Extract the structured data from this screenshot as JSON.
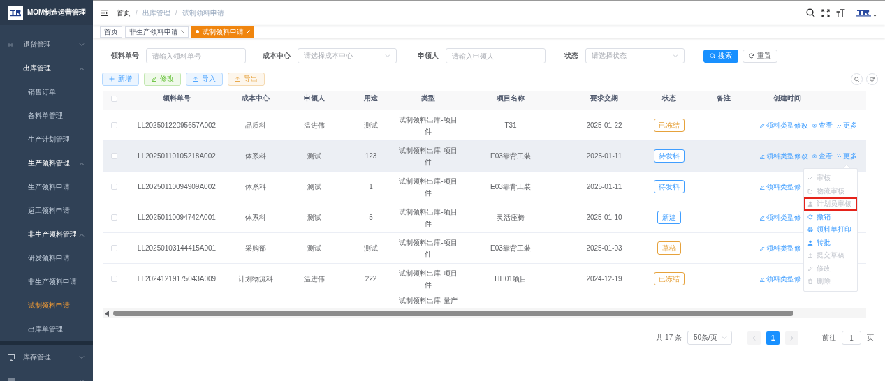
{
  "sidebar": {
    "title": "MOM制造运营管理",
    "items": [
      {
        "label": "退货管理",
        "expanded": false
      },
      {
        "label": "出库管理",
        "expanded": true,
        "children": [
          {
            "label": "销售订单",
            "selected": false
          },
          {
            "label": "备料单管理",
            "selected": false
          },
          {
            "label": "生产计划管理",
            "selected": false
          },
          {
            "label": "生产领料管理",
            "expanded": true,
            "children": [
              {
                "label": "生产领料申请",
                "selected": false
              },
              {
                "label": "返工领料申请",
                "selected": false
              }
            ]
          },
          {
            "label": "非生产领料管理",
            "expanded": true,
            "children": [
              {
                "label": "研发领料申请",
                "selected": false
              },
              {
                "label": "非生产领料申请",
                "selected": false
              },
              {
                "label": "试制领料申请",
                "selected": true
              }
            ]
          },
          {
            "label": "出库单管理",
            "selected": false
          }
        ]
      },
      {
        "label": "库存管理",
        "expanded": false
      },
      {
        "expanded": false
      }
    ]
  },
  "breadcrumb": [
    "首页",
    "出库管理",
    "试制领料申请"
  ],
  "breadcrumb_separators": [
    "/",
    "/"
  ],
  "tags": [
    {
      "label": "首页",
      "selected": false,
      "closable": false
    },
    {
      "label": "非生产领料申请",
      "selected": false,
      "closable": true
    },
    {
      "label": "试制领料申请",
      "selected": true,
      "closable": true
    }
  ],
  "filters": [
    {
      "label": "领料单号",
      "kind": "input",
      "placeholder": "请输入领料单号"
    },
    {
      "label": "成本中心",
      "kind": "select",
      "placeholder": "请选择成本中心"
    },
    {
      "label": "申领人",
      "kind": "input",
      "placeholder": "请输入申领人"
    },
    {
      "label": "状态",
      "kind": "select",
      "placeholder": "请选择状态"
    }
  ],
  "filter_buttons": [
    {
      "label": "搜索",
      "kind": "primary"
    },
    {
      "label": "重置",
      "kind": "plain"
    }
  ],
  "toolbar": [
    {
      "label": "新增",
      "kind": "add"
    },
    {
      "label": "修改",
      "kind": "edit"
    },
    {
      "label": "导入",
      "kind": "import"
    },
    {
      "label": "导出",
      "kind": "export"
    }
  ],
  "table": {
    "header_checked": false,
    "columns": [
      "领料单号",
      "成本中心",
      "申领人",
      "用途",
      "类型",
      "项目名称",
      "要求交期",
      "状态",
      "备注",
      "创建时间"
    ],
    "rows": [
      {
        "checked": false,
        "hovered": false,
        "code": "LL20250122095657A002",
        "cost_center": "品质科",
        "applicant": "温进伟",
        "purpose": "测试",
        "type": "试制领料出库-项目件",
        "project": "T31",
        "due_date": "2025-01-22",
        "status": {
          "label": "已冻结",
          "color": "#e6a23c"
        },
        "actions": [
          {
            "label": "领料类型修改",
            "kind": "edit"
          },
          {
            "label": "查看",
            "kind": "view"
          },
          {
            "label": "更多",
            "kind": "more"
          }
        ]
      },
      {
        "checked": false,
        "hovered": true,
        "code": "LL20250110105218A002",
        "cost_center": "体系科",
        "applicant": "测试",
        "purpose": "123",
        "type": "试制领料出库-项目件",
        "project": "E03靠背工装",
        "due_date": "2025-01-11",
        "status": {
          "label": "待发料",
          "color": "#409eff"
        },
        "actions": [
          {
            "label": "领料类型修改",
            "kind": "edit"
          },
          {
            "label": "查看",
            "kind": "view"
          },
          {
            "label": "更多",
            "kind": "more"
          }
        ]
      },
      {
        "checked": false,
        "hovered": false,
        "code": "LL20250110094909A002",
        "cost_center": "体系科",
        "applicant": "测试",
        "purpose": "1",
        "type": "试制领料出库-项目件",
        "project": "E03靠背工装",
        "due_date": "2025-01-11",
        "status": {
          "label": "待发料",
          "color": "#409eff"
        },
        "actions": [
          {
            "label": "领料类型修",
            "kind": "edit"
          }
        ]
      },
      {
        "checked": false,
        "hovered": false,
        "code": "LL20250110094742A001",
        "cost_center": "体系科",
        "applicant": "测试",
        "purpose": "5",
        "type": "试制领料出库-项目件",
        "project": "灵活座椅",
        "due_date": "2025-01-10",
        "status": {
          "label": "新建",
          "color": "#409eff"
        },
        "actions": [
          {
            "label": "领料类型修",
            "kind": "edit"
          }
        ]
      },
      {
        "checked": false,
        "hovered": false,
        "code": "LL20250103144415A001",
        "cost_center": "采购部",
        "applicant": "测试",
        "purpose": "测试",
        "type": "试制领料出库-项目件",
        "project": "E03靠背工装",
        "due_date": "2025-01-03",
        "status": {
          "label": "草稿",
          "color": "#e6a23c"
        },
        "actions": [
          {
            "label": "领料类型修",
            "kind": "edit"
          }
        ]
      },
      {
        "checked": false,
        "hovered": false,
        "code": "LL20241219175043A009",
        "cost_center": "计划物流科",
        "applicant": "温进伟",
        "purpose": "222",
        "type": "试制领料出库-项目件",
        "project": "HH01项目",
        "due_date": "2024-12-19",
        "status": {
          "label": "已冻结",
          "color": "#e6a23c"
        },
        "actions": [
          {
            "label": "领料类型修",
            "kind": "edit"
          }
        ]
      },
      {
        "type": "试制领料出库-量产"
      }
    ]
  },
  "more_menu": [
    {
      "label": "审核",
      "kind": "approve",
      "disabled": true,
      "highlighted": false
    },
    {
      "label": "物流审核",
      "kind": "logistics",
      "disabled": true,
      "highlighted": false
    },
    {
      "label": "计划员审核",
      "kind": "planner",
      "disabled": true,
      "highlighted": true
    },
    {
      "label": "撤销",
      "kind": "revoke",
      "disabled": false,
      "highlighted": false
    },
    {
      "label": "领料单打印",
      "kind": "print",
      "disabled": false,
      "highlighted": false
    },
    {
      "label": "转批",
      "kind": "transfer",
      "disabled": false,
      "highlighted": false
    },
    {
      "label": "提交草稿",
      "kind": "submit",
      "disabled": true,
      "highlighted": false
    },
    {
      "label": "修改",
      "kind": "edit",
      "disabled": true,
      "highlighted": false
    },
    {
      "label": "删除",
      "kind": "delete",
      "disabled": true,
      "highlighted": false
    }
  ],
  "pagination": {
    "total": "共 17 条",
    "page_size": "50条/页",
    "pages": [
      {
        "label": "1",
        "selected": true
      }
    ],
    "jump_label": "前往",
    "jump_value": "1",
    "unit": "页"
  }
}
